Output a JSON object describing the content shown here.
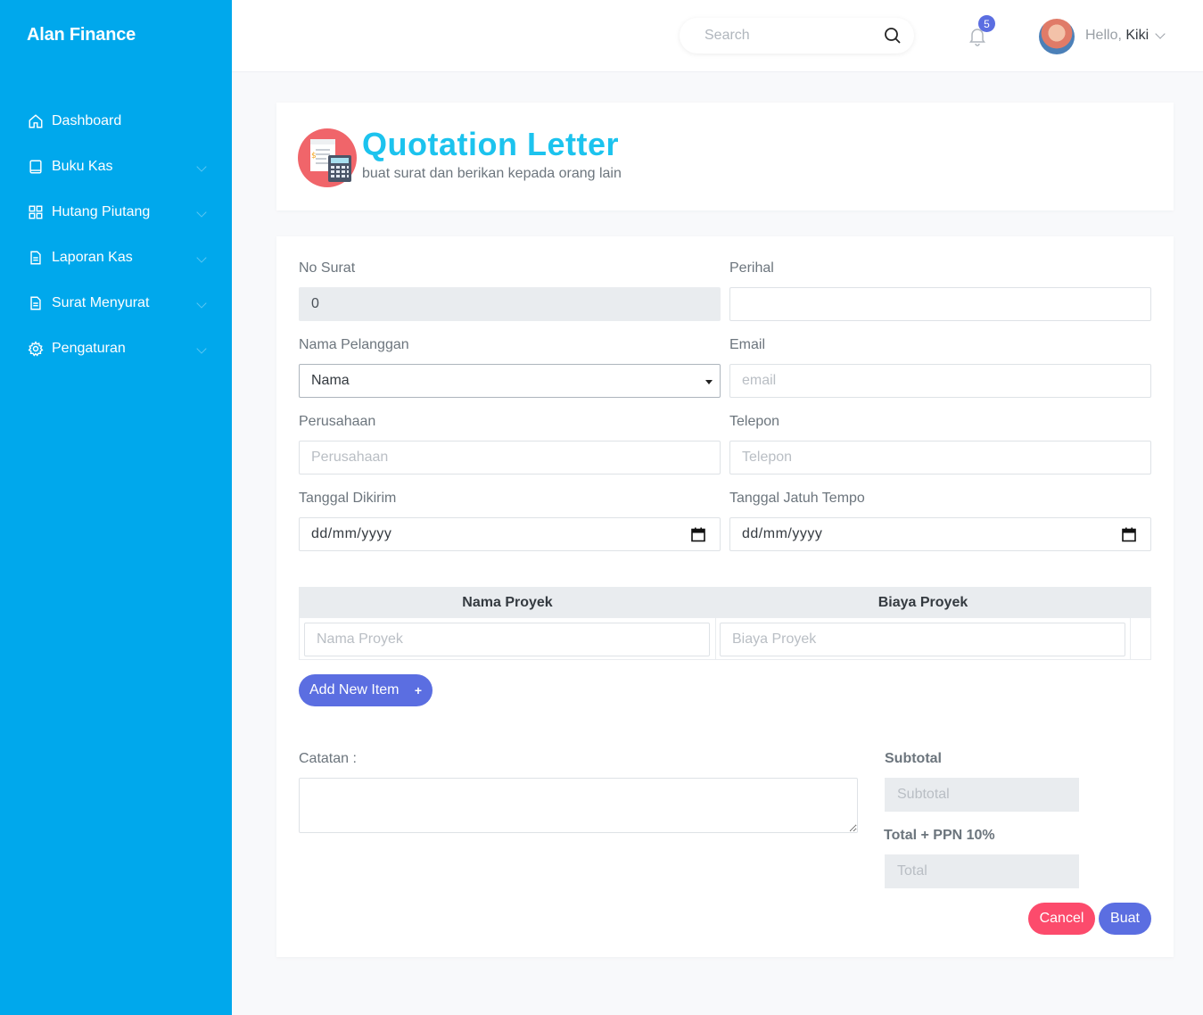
{
  "app": {
    "brand": "Alan Finance"
  },
  "sidebar": {
    "items": [
      {
        "label": "Dashboard",
        "icon": "home-icon",
        "has_submenu": false
      },
      {
        "label": "Buku Kas",
        "icon": "book-icon",
        "has_submenu": true
      },
      {
        "label": "Hutang Piutang",
        "icon": "grid-icon",
        "has_submenu": true
      },
      {
        "label": "Laporan Kas",
        "icon": "file-icon",
        "has_submenu": true
      },
      {
        "label": "Surat Menyurat",
        "icon": "file-icon",
        "has_submenu": true
      },
      {
        "label": "Pengaturan",
        "icon": "gear-icon",
        "has_submenu": true
      }
    ]
  },
  "topbar": {
    "search_placeholder": "Search",
    "notification_count": "5",
    "greeting": "Hello,",
    "username": "Kiki"
  },
  "header": {
    "title": "Quotation Letter",
    "subtitle": "buat surat dan berikan kepada orang lain",
    "icon": "calculator-invoice-icon"
  },
  "form": {
    "no_surat": {
      "label": "No Surat",
      "value": "0"
    },
    "perihal": {
      "label": "Perihal",
      "value": ""
    },
    "nama_pelanggan": {
      "label": "Nama Pelanggan",
      "selected": "Nama"
    },
    "email": {
      "label": "Email",
      "placeholder": "email"
    },
    "perusahaan": {
      "label": "Perusahaan",
      "placeholder": "Perusahaan"
    },
    "telepon": {
      "label": "Telepon",
      "placeholder": "Telepon"
    },
    "tanggal_dikirim": {
      "label": "Tanggal Dikirim",
      "value": "dd/mm/yyyy"
    },
    "tanggal_jatuh_tempo": {
      "label": "Tanggal Jatuh Tempo",
      "value": "dd/mm/yyyy"
    }
  },
  "items_table": {
    "headers": [
      "Nama Proyek",
      "Biaya Proyek"
    ],
    "row_placeholders": [
      "Nama Proyek",
      "Biaya Proyek"
    ]
  },
  "add_item_label": "Add New Item",
  "catatan_label": "Catatan :",
  "summary": {
    "subtotal_label": "Subtotal",
    "subtotal_placeholder": "Subtotal",
    "total_label": "Total + PPN 10%",
    "total_placeholder": "Total"
  },
  "actions": {
    "cancel": "Cancel",
    "submit": "Buat"
  },
  "colors": {
    "sidebar_bg": "#00a8ec",
    "title_color": "#1cc3ee",
    "primary": "#5b6ee1",
    "danger": "#fc4b6c"
  }
}
